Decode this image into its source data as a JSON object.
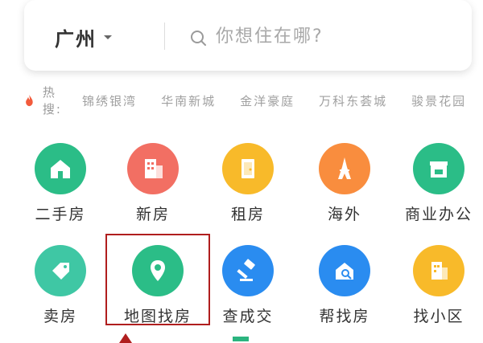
{
  "search": {
    "city": "广州",
    "placeholder": "你想住在哪?"
  },
  "hot": {
    "label": "热搜:",
    "tags": [
      "锦绣银湾",
      "华南新城",
      "金洋豪庭",
      "万科东荟城",
      "骏景花园"
    ]
  },
  "tiles": [
    {
      "label": "二手房",
      "icon": "house-icon",
      "color": "#2bbd87"
    },
    {
      "label": "新房",
      "icon": "building-icon",
      "color": "#f26f63"
    },
    {
      "label": "租房",
      "icon": "door-icon",
      "color": "#f8ba2a"
    },
    {
      "label": "海外",
      "icon": "tower-icon",
      "color": "#f98d3e"
    },
    {
      "label": "商业办公",
      "icon": "shop-icon",
      "color": "#2bbd87"
    },
    {
      "label": "卖房",
      "icon": "tag-icon",
      "color": "#3fc7a4"
    },
    {
      "label": "地图找房",
      "icon": "location-pin-icon",
      "color": "#2bbd87"
    },
    {
      "label": "查成交",
      "icon": "gavel-icon",
      "color": "#2a8cf0"
    },
    {
      "label": "帮找房",
      "icon": "house-search-icon",
      "color": "#2a8cf0"
    },
    {
      "label": "找小区",
      "icon": "community-icon",
      "color": "#f8ba2a"
    }
  ]
}
